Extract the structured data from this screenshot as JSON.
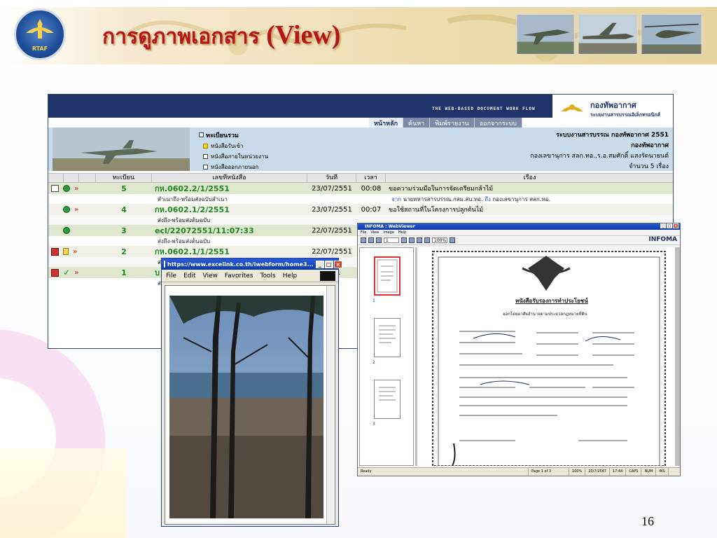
{
  "slide": {
    "title_thai": "การดูภาพเอกสาร",
    "title_en": "(View)",
    "page_number": "16",
    "logo_text": "RTAF"
  },
  "app": {
    "banner_text": "THE WEB-BASED DOCUMENT WORK FLOW",
    "brand_title": "กองทัพอากาศ",
    "brand_subtitle": "ระบบงานสารบรรณอิเล็กทรอนิกส์",
    "tabs": [
      {
        "label": "หน้าหลัก",
        "active": true
      },
      {
        "label": "ค้นหา",
        "active": false
      },
      {
        "label": "พิมพ์รายงาน",
        "active": false
      },
      {
        "label": "ออกจากระบบ",
        "active": false
      }
    ],
    "tree": {
      "root": "ทะเบียนรวม",
      "items": [
        "หนังสือรับเข้า",
        "หนังสือภายในหน่วยงาน",
        "หนังสือออกภายนอก"
      ]
    },
    "org": {
      "line1": "ระบบงานสารบรรณ กองทัพอากาศ 2551",
      "line2": "กองทัพอากาศ",
      "line3": "กองเลขานุการ สลก.ทอ.,ร.อ.สมศักดิ์ แสงรัตนายนต์",
      "line4": "จำนวน 5 เรื่อง"
    },
    "table": {
      "headers": [
        "ทะเบียน",
        "เลขที่หนังสือ",
        "วันที่",
        "เวลา",
        "เรื่อง"
      ],
      "rows": [
        {
          "no": "5",
          "doc": "กห.0602.2/1/2551",
          "date": "23/07/2551",
          "time": "00:08",
          "subject": "ขอความร่วมมือในการจัดเตรียมกล้าไม้",
          "sub": "สำเนาถึง-พร้อมส่งฉบับสำเนา",
          "from_label": "จาก",
          "from": "นายทหารสารบรรณ.กสม.สบ.ทอ.",
          "to_label": "ถึง",
          "to": "กองเลขานุการ สลก.ทอ."
        },
        {
          "no": "4",
          "doc": "กห.0602.1/2/2551",
          "date": "23/07/2551",
          "time": "00:07",
          "subject": "ขอใช้สถานที่ในโครงการปลูกต้นไม้",
          "sub": "ส่งถึง-พร้อมส่งต้นฉบับ"
        },
        {
          "no": "3",
          "doc": "ecl/22072551/11:07:33",
          "date": "22/07/2551",
          "time": "",
          "subject": "",
          "sub": "ส่งถึง-พร้อมส่งต้นฉบับ"
        },
        {
          "no": "2",
          "doc": "กห.0602.1/1/2551",
          "date": "22/07/2551",
          "time": "",
          "subject": "",
          "sub": "ส่งถึง"
        },
        {
          "no": "1",
          "doc": "บ",
          "date": "2551",
          "time": "",
          "subject": "",
          "sub": "ส่งถึง"
        }
      ]
    }
  },
  "popup": {
    "title": "https://www.excelink.co.th/iwebform/home3...",
    "menu": [
      "File",
      "Edit",
      "View",
      "Favorites",
      "Tools",
      "Help"
    ]
  },
  "viewer": {
    "title": "INFOMA : WebViewer",
    "menu": [
      "File",
      "View",
      "Image",
      "Help"
    ],
    "page_field": "1",
    "zoom_field": "100%",
    "brand": "INFOMA",
    "thumb_labels": [
      "1",
      "2",
      "3"
    ],
    "doc_title": "หนังสือรับรองการทำประโยชน์",
    "doc_subtitle": "ออกโดยอาศัยอำนาจตามประมวลกฎหมายที่ดิน",
    "status": [
      "Ready",
      "Page 1 of 3",
      "100%",
      "20/7/2547",
      "17:44",
      "CAPS",
      "NUM",
      "INS"
    ]
  },
  "colors": {
    "title_red": "#b5151a",
    "app_navy": "#1d3266",
    "record_green": "#1d8a1d",
    "link_blue": "#1a3fbf"
  }
}
